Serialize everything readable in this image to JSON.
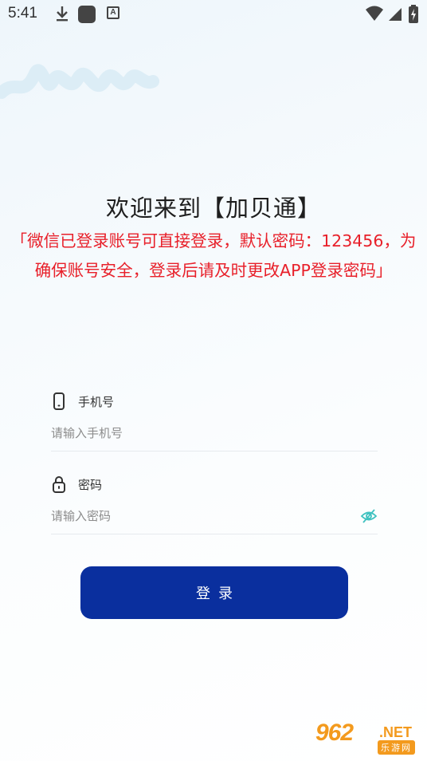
{
  "status_bar": {
    "time": "5:41",
    "icons": [
      "download-icon",
      "app-square-icon",
      "font-a-icon",
      "wifi-icon",
      "signal-icon",
      "battery-icon"
    ]
  },
  "welcome": {
    "title": "欢迎来到【加贝通】",
    "notice": "「微信已登录账号可直接登录，默认密码：123456，为确保账号安全，登录后请及时更改APP登录密码」",
    "notice_color": "#e8202a"
  },
  "form": {
    "phone": {
      "label": "手机号",
      "placeholder": "请输入手机号",
      "icon": "phone-icon"
    },
    "password": {
      "label": "密码",
      "placeholder": "请输入密码",
      "icon": "lock-icon",
      "toggle_icon": "eye-hidden-icon"
    },
    "login_button": "登录"
  },
  "watermark": {
    "logo": "962",
    "suffix": ".NET",
    "sub": "乐游网"
  },
  "colors": {
    "primary": "#0a2f9e",
    "accent_teal": "#3fc2c0",
    "watermark": "#f39a1e"
  }
}
